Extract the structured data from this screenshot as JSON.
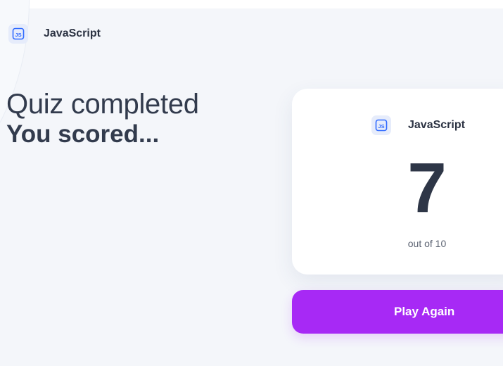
{
  "header": {
    "subject": "JavaScript",
    "icon": "js-icon"
  },
  "heading": {
    "line1": "Quiz completed",
    "line2": "You scored..."
  },
  "score_card": {
    "subject": "JavaScript",
    "icon": "js-icon",
    "score": "7",
    "total_text": "out of 10"
  },
  "actions": {
    "play_again_label": "Play Again"
  },
  "colors": {
    "accent": "#a729f5",
    "background": "#f4f6fa",
    "icon_bg": "#e6ecfb",
    "icon_stroke": "#306aff",
    "text_dark": "#2e3647"
  }
}
